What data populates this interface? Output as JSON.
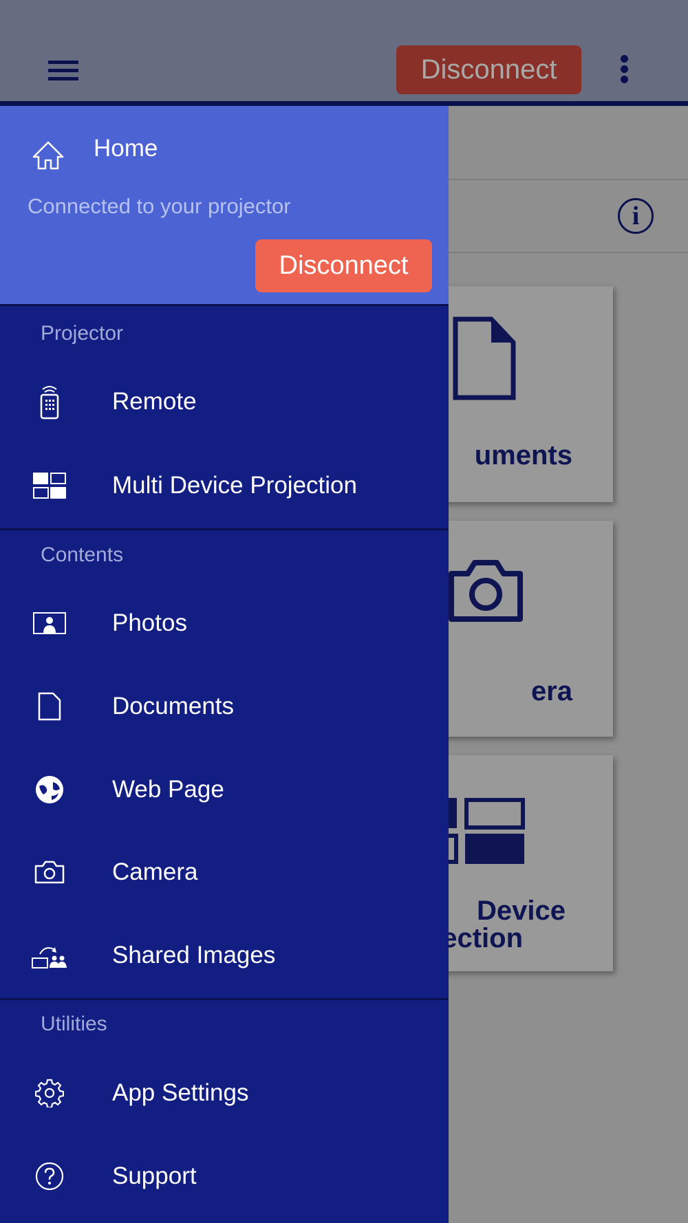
{
  "topbar": {
    "disconnect_label": "Disconnect",
    "menu_icon": "hamburger-icon",
    "more_icon": "kebab-icon",
    "info_icon": "info-icon",
    "info_glyph": "i"
  },
  "background_cards": [
    {
      "label": "uments",
      "icon": "document-icon"
    },
    {
      "label": "era",
      "icon": "camera-icon"
    },
    {
      "label_line1": "Device",
      "label_line2": "ection",
      "icon": "multi-device-icon"
    }
  ],
  "drawer": {
    "home": {
      "title": "Home",
      "subtitle": "Connected to your projector",
      "disconnect_label": "Disconnect",
      "icon": "home-icon"
    },
    "sections": [
      {
        "title": "Projector",
        "items": [
          {
            "label": "Remote",
            "icon": "remote-icon"
          },
          {
            "label": "Multi Device Projection",
            "icon": "multi-device-icon"
          }
        ]
      },
      {
        "title": "Contents",
        "items": [
          {
            "label": "Photos",
            "icon": "photo-icon"
          },
          {
            "label": "Documents",
            "icon": "document-icon"
          },
          {
            "label": "Web Page",
            "icon": "globe-icon"
          },
          {
            "label": "Camera",
            "icon": "camera-icon"
          },
          {
            "label": "Shared Images",
            "icon": "shared-images-icon"
          }
        ]
      },
      {
        "title": "Utilities",
        "items": [
          {
            "label": "App Settings",
            "icon": "gear-icon"
          },
          {
            "label": "Support",
            "icon": "help-icon"
          }
        ]
      }
    ]
  },
  "colors": {
    "drawer": "#131e82",
    "home": "#4b63d3",
    "disconnect": "#ee6450",
    "topbar": "#676c80"
  }
}
